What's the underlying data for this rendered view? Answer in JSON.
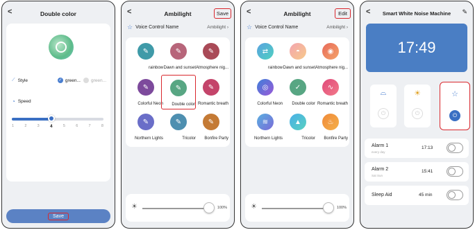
{
  "screen1": {
    "title": "Double color",
    "back": "<",
    "style_label": "Style",
    "style_opt1": "green...",
    "style_opt2": "green...",
    "speed_label": "Speed",
    "speed_ticks": [
      "1",
      "2",
      "3",
      "4",
      "5",
      "6",
      "7",
      "8"
    ],
    "speed_value": 4,
    "save_label": "Save"
  },
  "screen2": {
    "title": "Ambilight",
    "back": "<",
    "save_label": "Save",
    "voice_label": "Voice Control Name",
    "voice_value": "Ambilight",
    "scenes": [
      "rainbow",
      "Dawn and sunset",
      "Atmosphere nig...",
      "Colorful Neon",
      "Double color",
      "Romantic breath",
      "Northern Lights",
      "Tricolor",
      "Bonfire Party"
    ],
    "brightness_pct": "100%"
  },
  "screen3": {
    "title": "Ambilight",
    "back": "<",
    "edit_label": "Edit",
    "voice_label": "Voice Control Name",
    "voice_value": "Ambilight",
    "scenes": [
      "rainbow",
      "Dawn and sunset",
      "Atmosphere nig...",
      "Colorful Neon",
      "Double color",
      "Romantic breath",
      "Northern Lights",
      "Tricolor",
      "Bonfire Party"
    ],
    "brightness_pct": "100%"
  },
  "screen4": {
    "title": "Smart White Noise Machine",
    "back": "<",
    "time": "17:49",
    "alarm1_label": "Alarm 1",
    "alarm1_sub": "every day",
    "alarm1_time": "17:13",
    "alarm2_label": "Alarm 2",
    "alarm2_sub": "Sat Sun",
    "alarm2_time": "15:41",
    "sleep_label": "Sleep Aid",
    "sleep_time": "45 min"
  },
  "colors": {
    "accent": "#3a6fc3",
    "highlight": "#d9262c"
  }
}
